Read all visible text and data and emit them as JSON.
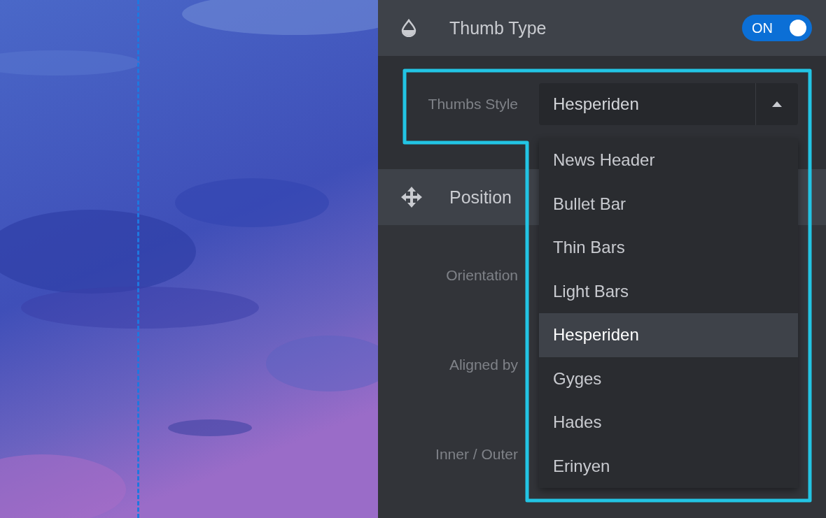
{
  "header": {
    "title": "Thumb Type",
    "toggle": {
      "label": "ON",
      "on": true
    }
  },
  "thumbs_style": {
    "label": "Thumbs Style",
    "value": "Hesperiden",
    "open": true,
    "options": [
      {
        "label": "News Header",
        "selected": false
      },
      {
        "label": "Bullet Bar",
        "selected": false
      },
      {
        "label": "Thin Bars",
        "selected": false
      },
      {
        "label": "Light Bars",
        "selected": false
      },
      {
        "label": "Hesperiden",
        "selected": true
      },
      {
        "label": "Gyges",
        "selected": false
      },
      {
        "label": "Hades",
        "selected": false
      },
      {
        "label": "Erinyen",
        "selected": false
      }
    ]
  },
  "position": {
    "title": "Position",
    "rows": [
      {
        "label": "Orientation"
      },
      {
        "label": "Aligned by"
      },
      {
        "label": "Inner / Outer"
      }
    ]
  }
}
